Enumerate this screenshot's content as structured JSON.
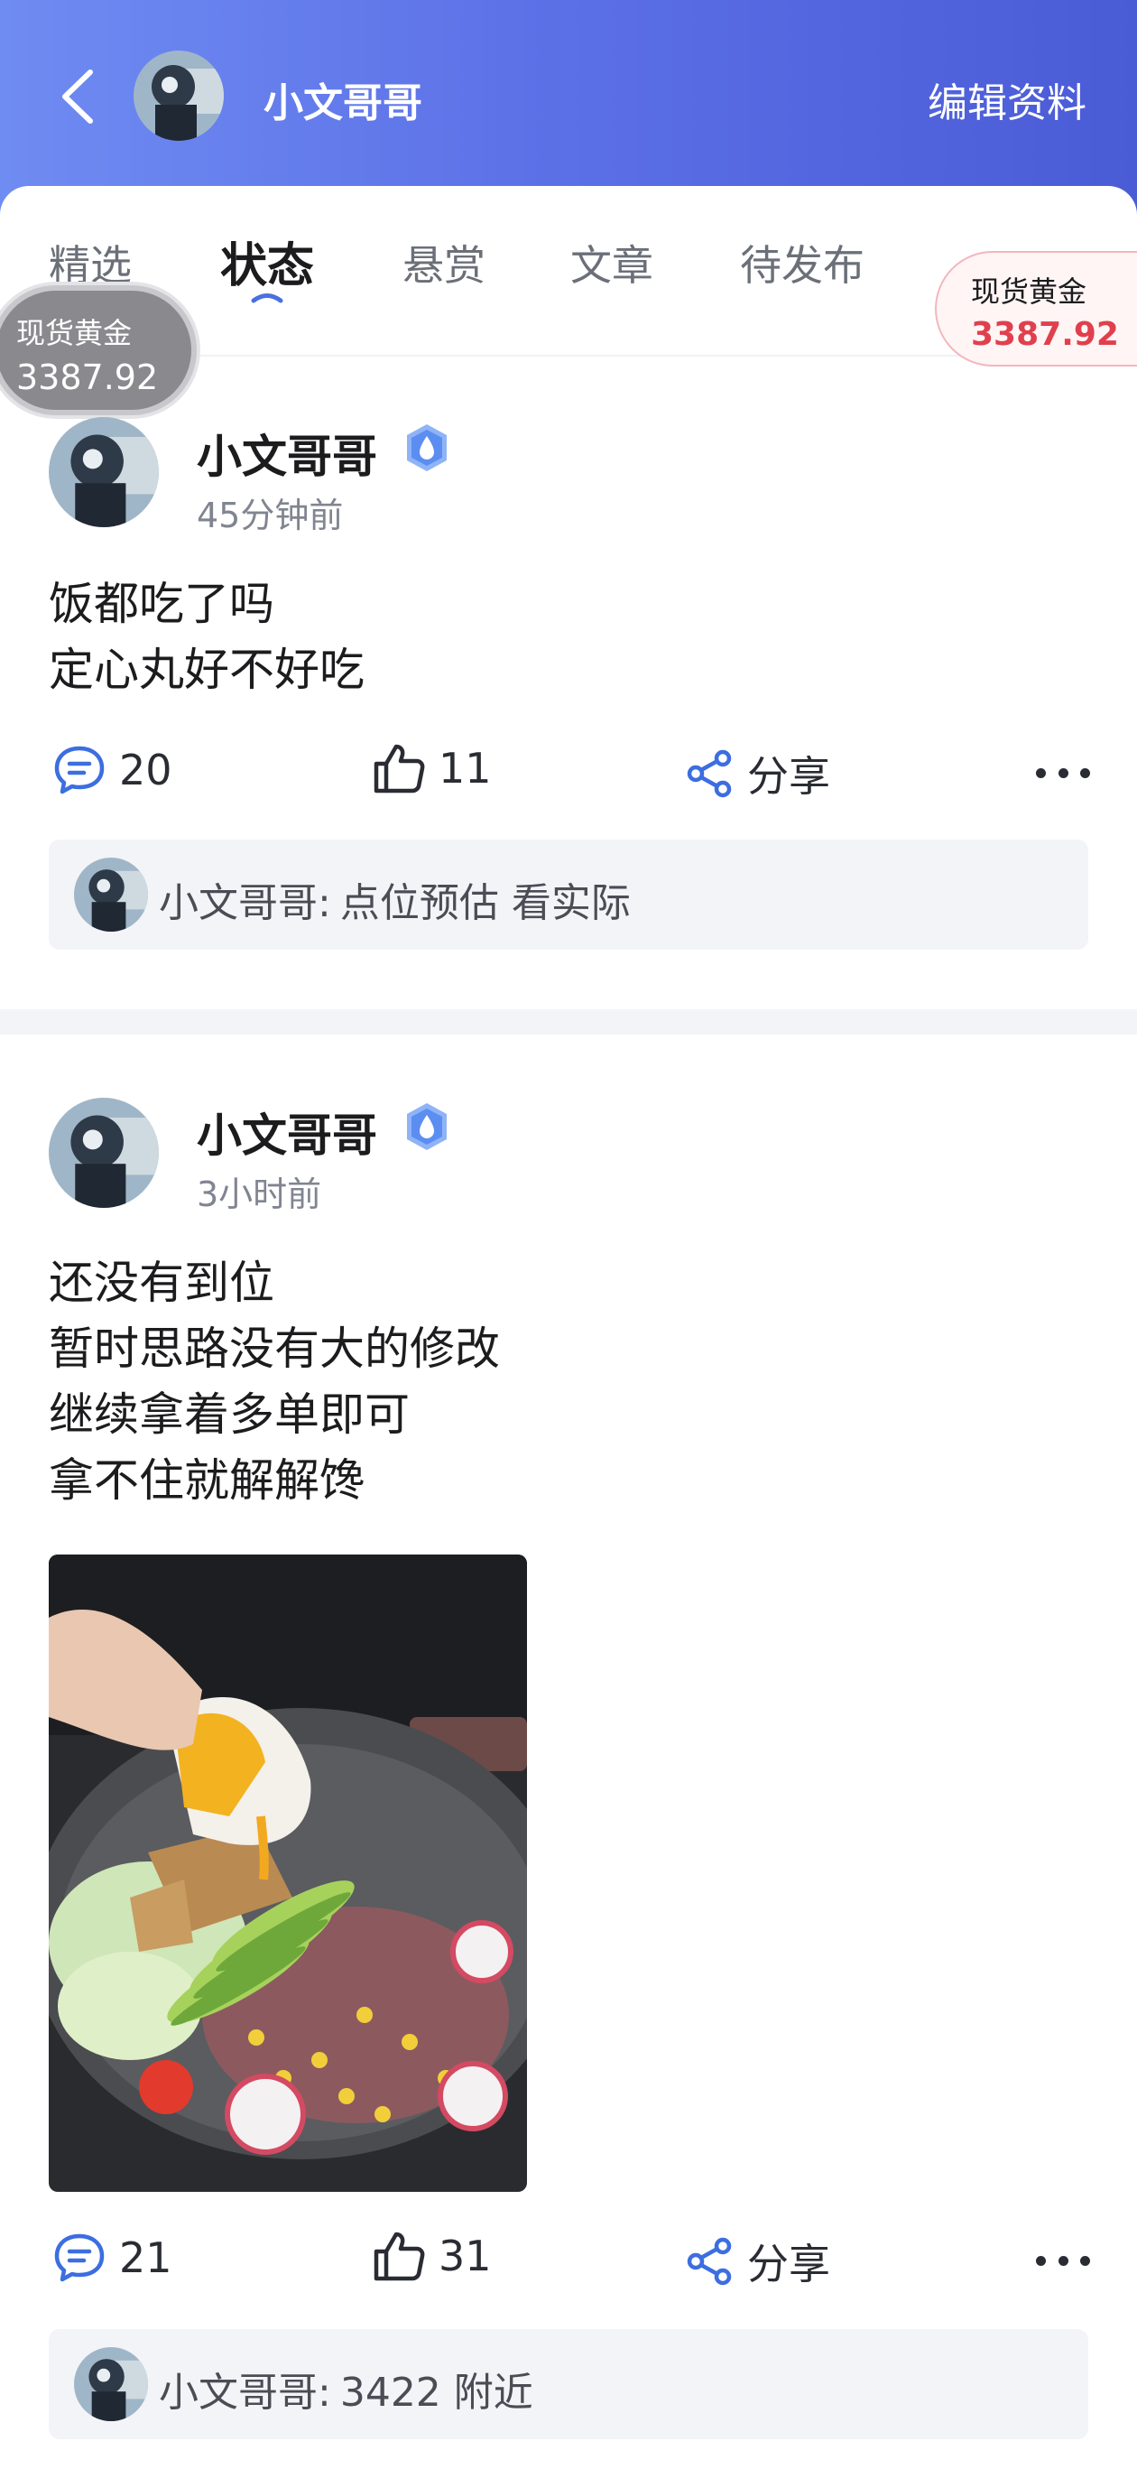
{
  "header": {
    "user_name": "小文哥哥",
    "edit_label": "编辑资料"
  },
  "tabs": [
    {
      "label": "精选",
      "active": false
    },
    {
      "label": "状态",
      "active": true
    },
    {
      "label": "悬赏",
      "active": false
    },
    {
      "label": "文章",
      "active": false
    },
    {
      "label": "待发布",
      "active": false
    }
  ],
  "gold_float_left": {
    "label": "现货黄金",
    "value": "3387.92"
  },
  "gold_float_right": {
    "label": "现货黄金",
    "value": "3387.92"
  },
  "posts": [
    {
      "author": "小文哥哥",
      "time": "45分钟前",
      "lines": [
        "饭都吃了吗",
        "定心丸好不好吃"
      ],
      "comments": "20",
      "likes": "11",
      "share_label": "分享",
      "top_comment": {
        "author": "小文哥哥",
        "separator": ":",
        "text": "点位预估 看实际"
      }
    },
    {
      "author": "小文哥哥",
      "time": "3小时前",
      "lines": [
        "还没有到位",
        "暂时思路没有大的修改",
        "继续拿着多单即可",
        "拿不住就解解馋"
      ],
      "comments": "21",
      "likes": "31",
      "share_label": "分享",
      "top_comment": {
        "author": "小文哥哥",
        "separator": ":",
        "text": "3422 附近"
      }
    }
  ],
  "colors": {
    "header_gradient_start": "#6f8cf2",
    "header_gradient_end": "#4a5bd6",
    "accent_blue": "#4a6fe0",
    "gold_price_red": "#e0404e",
    "comment_bg": "#f3f4f7"
  },
  "icons": [
    "back-arrow-icon",
    "verified-badge-icon",
    "comment-icon",
    "like-icon",
    "share-icon",
    "more-icon"
  ]
}
